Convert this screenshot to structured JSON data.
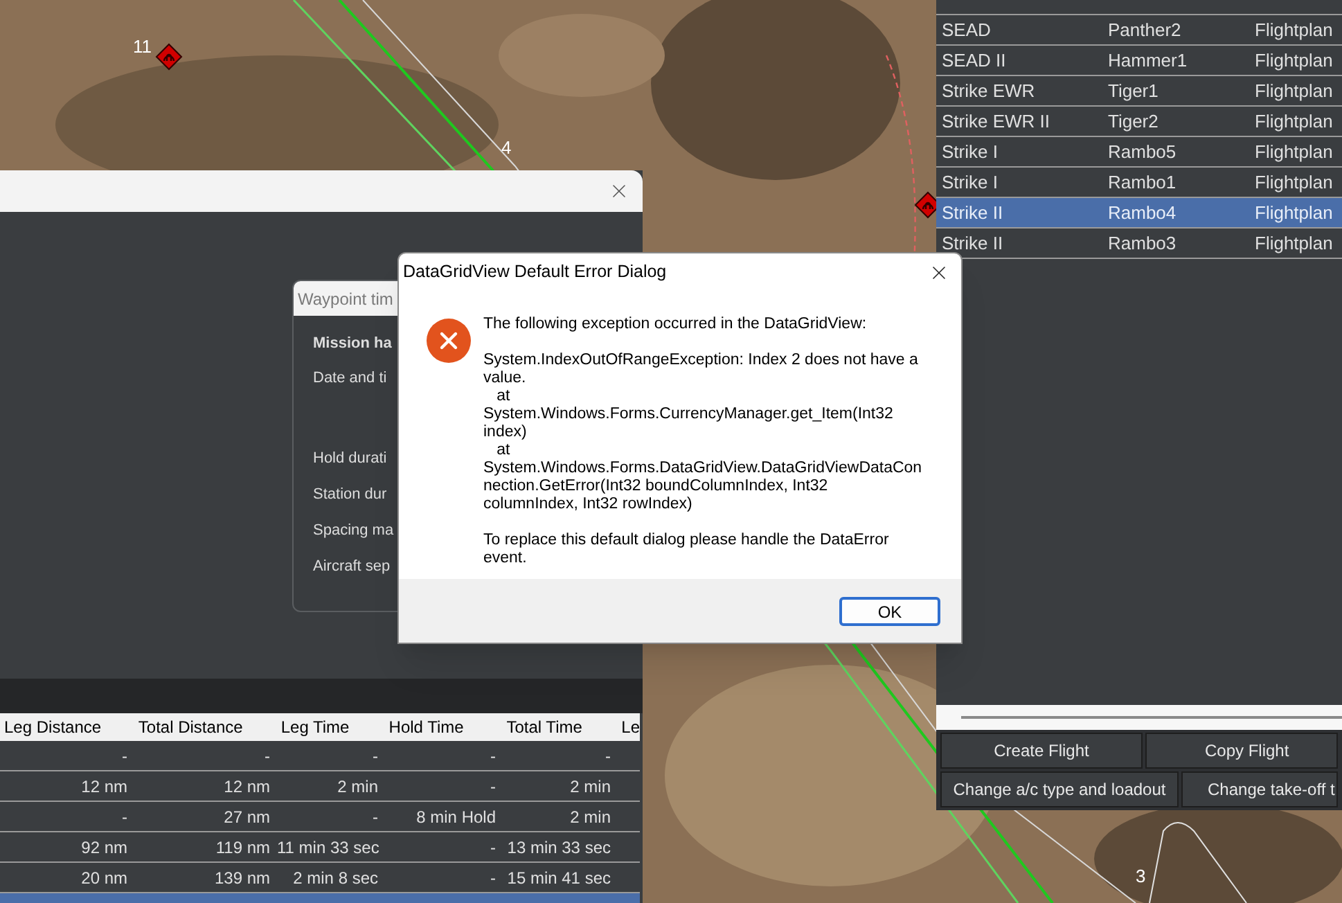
{
  "map": {
    "labels": [
      "11",
      "4",
      "3"
    ]
  },
  "flights": {
    "rows": [
      {
        "cells": [
          "SEAD",
          "Panther2",
          "Flightplan"
        ],
        "selected": false
      },
      {
        "cells": [
          "SEAD II",
          "Hammer1",
          "Flightplan"
        ],
        "selected": false
      },
      {
        "cells": [
          "Strike EWR",
          "Tiger1",
          "Flightplan"
        ],
        "selected": false
      },
      {
        "cells": [
          "Strike EWR II",
          "Tiger2",
          "Flightplan"
        ],
        "selected": false
      },
      {
        "cells": [
          "Strike I",
          "Rambo5",
          "Flightplan"
        ],
        "selected": false
      },
      {
        "cells": [
          "Strike I",
          "Rambo1",
          "Flightplan"
        ],
        "selected": false
      },
      {
        "cells": [
          "Strike II",
          "Rambo4",
          "Flightplan"
        ],
        "selected": true
      },
      {
        "cells": [
          "Strike II",
          "Rambo3",
          "Flightplan"
        ],
        "selected": false
      }
    ],
    "buttons": [
      [
        "Create Flight",
        "Copy Flight"
      ],
      [
        "Change a/c type and loadout",
        "Change take-off t"
      ]
    ]
  },
  "main_window": {
    "table": {
      "columns": [
        "Leg Distance",
        "Total Distance",
        "Leg Time",
        "Hold Time",
        "Total Time",
        "Le"
      ],
      "rows": [
        {
          "cells": [
            "-",
            "-",
            "-",
            "-",
            "-"
          ],
          "selected": false
        },
        {
          "cells": [
            "12 nm",
            "12 nm",
            "2 min",
            "-",
            "2 min"
          ],
          "selected": false
        },
        {
          "cells": [
            "-",
            "27 nm",
            "-",
            "8 min Hold",
            "2 min"
          ],
          "selected": false
        },
        {
          "cells": [
            "92 nm",
            "119 nm",
            "11 min 33 sec",
            "-",
            "13 min 33 sec"
          ],
          "selected": false
        },
        {
          "cells": [
            "20 nm",
            "139 nm",
            "2 min 8 sec",
            "-",
            "15 min 41 sec"
          ],
          "selected": false
        },
        {
          "cells": [],
          "selected": true
        }
      ]
    }
  },
  "waypoint_window": {
    "title": "Waypoint tim",
    "fields": [
      {
        "label": "Mission ha",
        "kind": "heading"
      },
      {
        "label": "Date and ti",
        "kind": "datetime"
      },
      {
        "label": "Hold durati",
        "kind": "field"
      },
      {
        "label": "Station dur",
        "kind": "field"
      },
      {
        "label": "Spacing ma",
        "kind": "field"
      },
      {
        "label": "Aircraft sep",
        "kind": "field"
      }
    ]
  },
  "error_dialog": {
    "title": "DataGridView Default Error Dialog",
    "message": [
      "The following exception occurred in the DataGridView:",
      "System.IndexOutOfRangeException: Index 2 does not have a value.\n   at System.Windows.Forms.CurrencyManager.get_Item(Int32 index)\n   at System.Windows.Forms.DataGridView.DataGridViewDataConnection.GetError(Int32 boundColumnIndex, Int32 columnIndex, Int32 rowIndex)",
      "To replace this default dialog please handle the DataError event."
    ],
    "buttons": [
      "OK"
    ]
  }
}
